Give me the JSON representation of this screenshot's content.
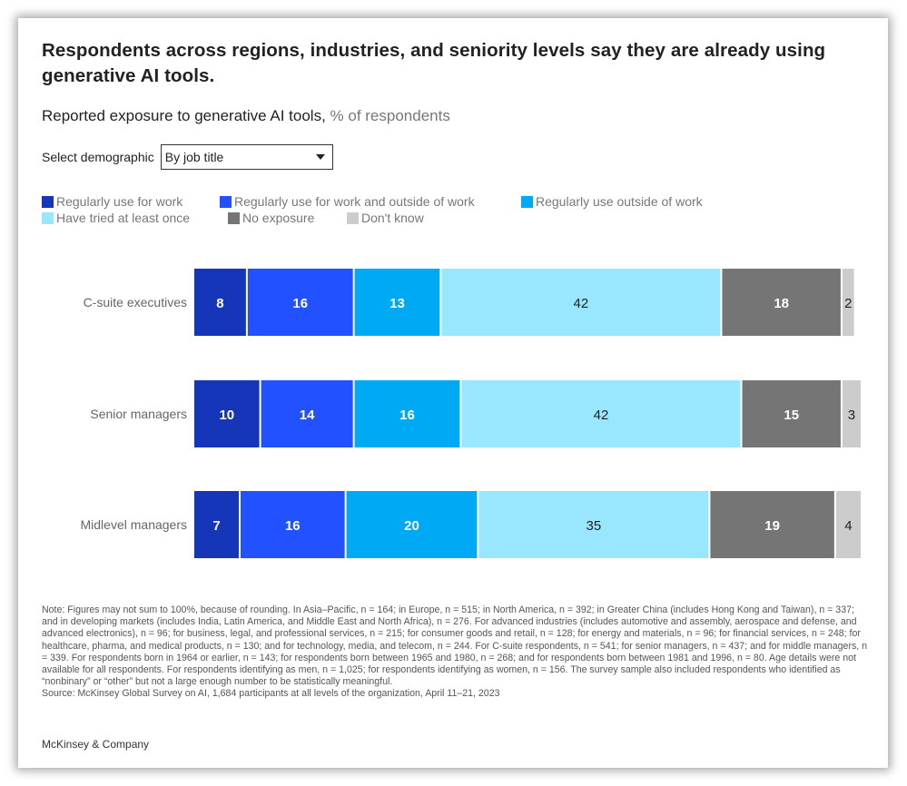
{
  "header": {
    "title": "Respondents across regions, industries, and seniority levels say they are already using generative AI tools.",
    "subtitle_main": "Reported exposure to generative AI tools,",
    "subtitle_unit": " % of respondents"
  },
  "demographic": {
    "label": "Select demographic",
    "selected": "By job title"
  },
  "legend": [
    {
      "label": "Regularly use for work",
      "color": "#1536b8"
    },
    {
      "label": "Regularly use for work and outside of work",
      "color": "#2251ff"
    },
    {
      "label": "Regularly use outside of work",
      "color": "#00a9f4"
    },
    {
      "label": "Have tried at least once",
      "color": "#99e6ff"
    },
    {
      "label": "No exposure",
      "color": "#757575"
    },
    {
      "label": "Don't know",
      "color": "#cccccc"
    }
  ],
  "chart_data": {
    "type": "bar",
    "orientation": "horizontal-stacked",
    "title": "Reported exposure to generative AI tools",
    "unit": "% of respondents",
    "categories": [
      "C-suite executives",
      "Senior managers",
      "Midlevel managers"
    ],
    "series": [
      {
        "name": "Regularly use for work",
        "color": "#1536b8",
        "label_color": "#ffffff",
        "values": [
          8,
          10,
          7
        ]
      },
      {
        "name": "Regularly use for work and outside of work",
        "color": "#2251ff",
        "label_color": "#ffffff",
        "values": [
          16,
          14,
          16
        ]
      },
      {
        "name": "Regularly use outside of work",
        "color": "#00a9f4",
        "label_color": "#ffffff",
        "values": [
          13,
          16,
          20
        ]
      },
      {
        "name": "Have tried at least once",
        "color": "#99e6ff",
        "label_color": "#222222",
        "values": [
          42,
          42,
          35
        ]
      },
      {
        "name": "No exposure",
        "color": "#757575",
        "label_color": "#ffffff",
        "values": [
          18,
          15,
          19
        ]
      },
      {
        "name": "Don't know",
        "color": "#cccccc",
        "label_color": "#222222",
        "values": [
          2,
          3,
          4
        ]
      }
    ],
    "xlim": [
      0,
      100
    ],
    "grid": false,
    "legend_position": "top-left"
  },
  "footer": {
    "note": "Note: Figures may not sum to 100%, because of rounding. In Asia–Pacific, n = 164; in Europe, n = 515; in North America, n = 392; in Greater China (includes Hong Kong and Taiwan), n = 337; and in developing markets (includes India, Latin America, and Middle East and North Africa), n = 276. For advanced industries (includes automotive and assembly, aerospace and defense, and advanced electronics), n = 96; for business, legal, and professional services, n = 215; for consumer goods and retail, n = 128; for energy and materials, n = 96; for financial services, n = 248; for healthcare, pharma, and medical products, n = 130; and for technology, media, and telecom, n = 244. For C-suite respondents, n = 541; for senior managers, n = 437; and for middle managers, n = 339. For respondents born in 1964 or earlier, n = 143; for respondents born between 1965 and 1980, n = 268; and for respondents born between 1981 and 1996, n = 80. Age details were not available for all respondents. For respondents identifying as men, n = 1,025; for respondents identifying as women, n = 156. The survey sample also included respondents who identified as “nonbinary” or “other” but not a large enough number to be statistically meaningful.",
    "source": "Source: McKinsey Global Survey on AI, 1,684 participants at all levels of the organization, April 11–21, 2023",
    "brand": "McKinsey & Company"
  }
}
